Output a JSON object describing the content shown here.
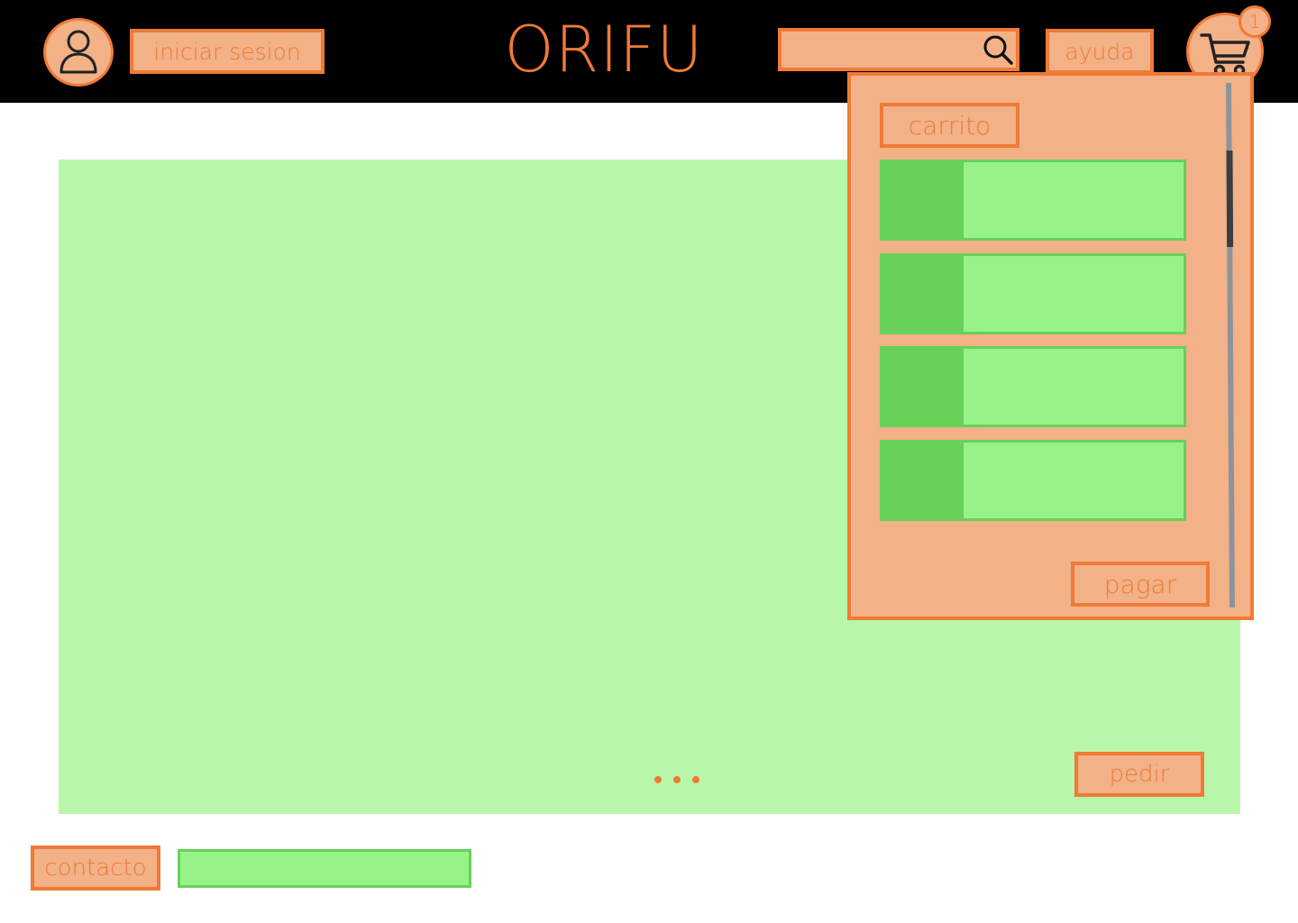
{
  "header": {
    "avatar_icon": "user-icon",
    "login_label": "iniciar sesion",
    "logo": "ORIFU",
    "search": {
      "value": "",
      "placeholder": "",
      "icon": "search-icon"
    },
    "help_label": "ayuda",
    "cart": {
      "icon": "shopping-cart-icon",
      "badge": "1"
    }
  },
  "hero": {
    "carousel_dots": 3,
    "order_label": "pedir"
  },
  "cart_panel": {
    "title": "carrito",
    "items": 4,
    "pay_label": "pagar"
  },
  "footer": {
    "contact_label": "contacto"
  },
  "colors": {
    "accent": "#f07a36",
    "accent_fill": "#f2b187",
    "hero_green": "#b8f7aa",
    "item_green": "#97f287",
    "item_dark_green": "#67d15a",
    "header_bg": "#000000"
  }
}
